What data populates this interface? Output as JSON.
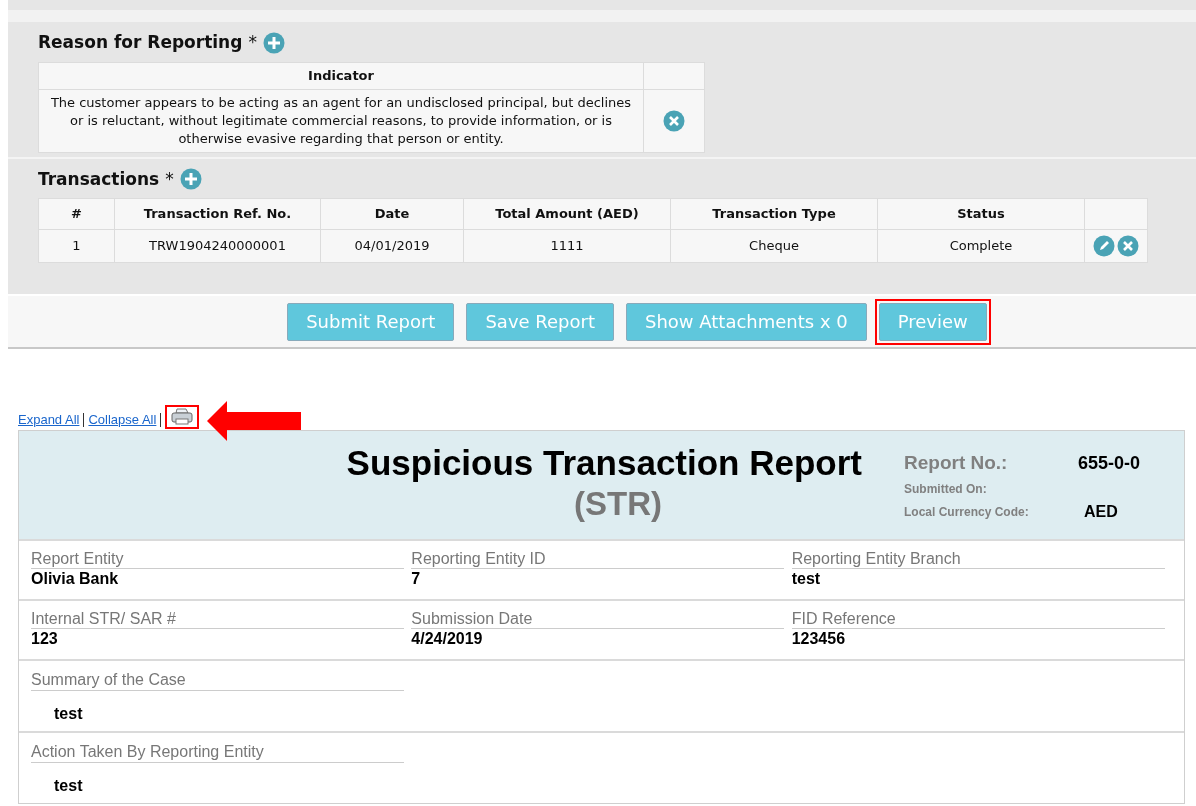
{
  "reason_section": {
    "title": "Reason for Reporting",
    "required_mark": "*",
    "table": {
      "columns": [
        "Indicator"
      ],
      "rows": [
        {
          "indicator": "The customer appears to be acting as an agent for an undisclosed principal, but declines or is reluctant, without legitimate commercial reasons, to provide information, or is otherwise evasive regarding that person or entity."
        }
      ]
    }
  },
  "transactions_section": {
    "title": "Transactions",
    "required_mark": "*",
    "table": {
      "columns": [
        "#",
        "Transaction Ref. No.",
        "Date",
        "Total Amount (AED)",
        "Transaction Type",
        "Status"
      ],
      "rows": [
        [
          "1",
          "TRW1904240000001",
          "04/01/2019",
          "1111",
          "Cheque",
          "Complete"
        ]
      ]
    }
  },
  "buttons": [
    {
      "label": "Submit Report",
      "highlighted": false
    },
    {
      "label": "Save Report",
      "highlighted": false
    },
    {
      "label": "Show Attachments x 0",
      "highlighted": false
    },
    {
      "label": "Preview",
      "highlighted": true
    }
  ],
  "preview_links": [
    {
      "label": "Expand All"
    },
    {
      "label": "Collapse All"
    }
  ],
  "print_icon": {
    "highlighted": true
  },
  "report": {
    "title": "Suspicious Transaction Report",
    "subtitle": "(STR)",
    "meta": [
      {
        "label": "Report No.:",
        "value": "655-0-0",
        "kind": "large"
      },
      {
        "label": "Submitted On:",
        "kind": "small"
      },
      {
        "label": "Local Currency Code:",
        "value": "AED",
        "kind": "small"
      }
    ],
    "field_rows": [
      [
        {
          "label": "Report Entity",
          "value": "Olivia Bank"
        },
        {
          "label": "Reporting Entity ID",
          "value": "7"
        },
        {
          "label": "Reporting Entity Branch",
          "value": "test"
        }
      ],
      [
        {
          "label": "Internal STR/ SAR #",
          "value": "123"
        },
        {
          "label": "Submission Date",
          "value": "4/24/2019"
        },
        {
          "label": "FID Reference",
          "value": "123456"
        }
      ]
    ],
    "text_fields": [
      {
        "label": "Summary of the Case",
        "value": "test"
      },
      {
        "label": "Action Taken By Reporting Entity",
        "value": "test"
      }
    ]
  }
}
